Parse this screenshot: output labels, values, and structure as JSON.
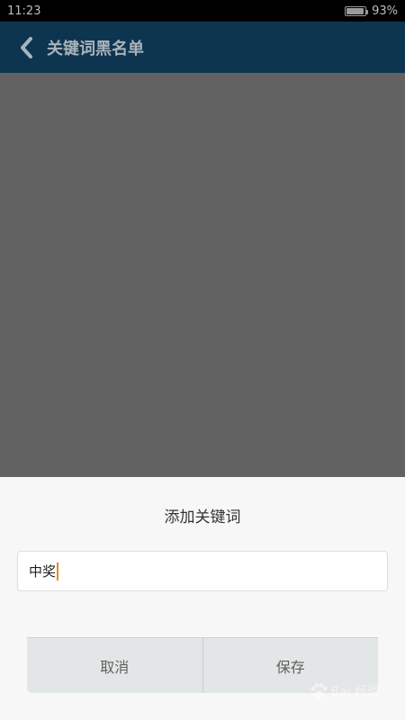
{
  "status_bar": {
    "time": "11:23",
    "battery_percent": "93%",
    "battery_level": 0.93
  },
  "header": {
    "back_icon": "chevron-left-icon",
    "title": "关键词黑名单"
  },
  "dialog": {
    "title": "添加关键词",
    "input_value": "中奖",
    "cancel_label": "取消",
    "save_label": "保存"
  },
  "watermark": {
    "text": "Bai 经验"
  },
  "colors": {
    "header_bg": "#0e3550",
    "overlay": "#626262",
    "dialog_bg": "#f7f7f7",
    "caret": "#e38b1e"
  }
}
